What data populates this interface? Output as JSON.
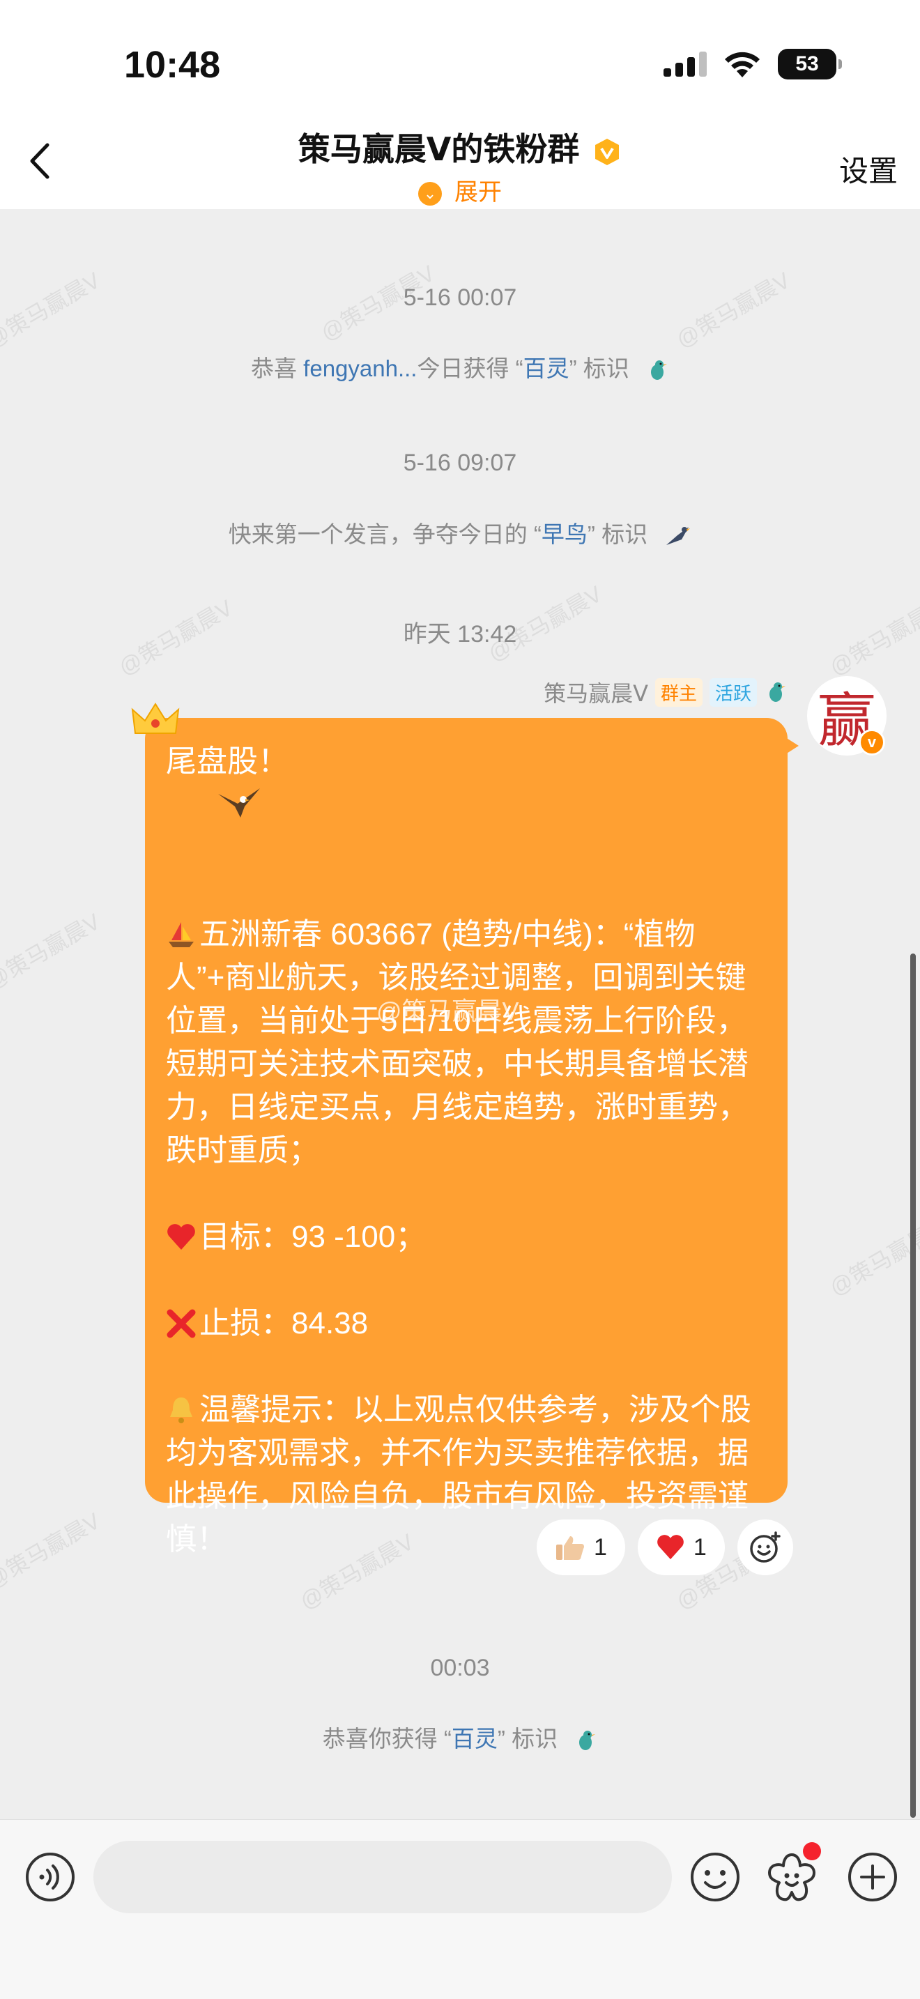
{
  "status_bar": {
    "time": "10:48",
    "battery": "53"
  },
  "nav": {
    "title": "策马赢晨Ⅴ的铁粉群",
    "expand_label": "展开",
    "settings_label": "设置"
  },
  "watermark": "@策马赢晨V",
  "messages": {
    "ts1": "5-16 00:07",
    "sys1": {
      "prefix": "恭喜 ",
      "user": "fengyanh...",
      "mid": "今日获得 “",
      "hl": "百灵",
      "suffix": "” 标识"
    },
    "ts2": "5-16 09:07",
    "sys2": {
      "prefix": "快来第一个发言，争夺今日的 “",
      "hl": "早鸟",
      "suffix": "” 标识"
    },
    "ts3": "昨天 13:42",
    "sender": {
      "name": "策马赢晨Ⅴ",
      "tag_owner": "群主",
      "tag_active": "活跃",
      "avatar_char": "赢"
    },
    "post": {
      "line_title": "尾盘股！",
      "para1": "五洲新春 603667 (趋势/中线)：“植物人”+商业航天，该股经过调整，回调到关键位置，当前处于5日/10日线震荡上行阶段，短期可关注技术面突破，中长期具备增长潜力，日线定买点，月线定趋势，涨时重势，跌时重质；",
      "target": "目标：93 -100；",
      "stoploss": "止损：84.38",
      "notice": "温馨提示：以上观点仅供参考，涉及个股均为客观需求，并不作为买卖推荐依据，据此操作，风险自负，股市有风险，投资需谨慎！"
    },
    "reactions": {
      "thumbs_count": "1",
      "heart_count": "1"
    },
    "overlay_watermark": "@策马赢晨V",
    "ts4": "00:03",
    "sys3": {
      "prefix": "恭喜你获得 “",
      "hl": "百灵",
      "suffix": "” 标识"
    }
  },
  "input": {
    "placeholder": ""
  },
  "colors": {
    "accent": "#ff8200",
    "bubble": "#ffa032",
    "link": "#3e76b3"
  }
}
